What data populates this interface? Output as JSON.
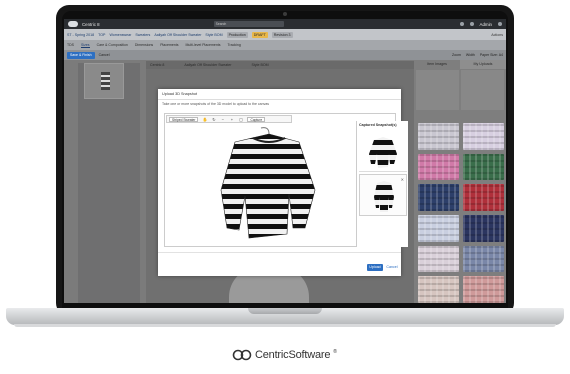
{
  "app": {
    "title": "Centric 8",
    "user": "Admin",
    "search_placeholder": "Search"
  },
  "breadcrumb": {
    "items": [
      "ST - Spring 2018",
      "TOP",
      "Womenswear",
      "Sweaters",
      "Aaliyah Off Shoulder Sweater",
      "Style BOM"
    ],
    "badges": [
      "Production",
      "DRAFT",
      "Revision 3"
    ],
    "actions_label": "Actions"
  },
  "tabs": [
    "TDS",
    "Sizes",
    "Care & Composition",
    "Dimensions",
    "Placements",
    "Multi-level Placements",
    "Tracking"
  ],
  "toolbar": {
    "save_label": "Save & Finish",
    "cancel_label": "Cancel",
    "zoom_label": "Zoom",
    "zoom_value": "Width",
    "paper_label": "Paper Size: A4"
  },
  "table_header": [
    "Centric 8",
    "Aaliyah Off Shoulder Sweater",
    "Style BOM"
  ],
  "right_panel": {
    "tabs": [
      "Item Images",
      "My Uploads"
    ]
  },
  "modal": {
    "title": "Upload 3D Snapshot",
    "description": "Take one or more snapshots of the 3D model to upload to the canvas",
    "view_select": "Striped Sweater",
    "capture_label": "Capture",
    "captured_title": "Captured Snapshot(s)",
    "upload_label": "Upload",
    "cancel_label": "Cancel"
  },
  "swatches": [
    "#c9c7d1",
    "#d7cfe0",
    "#d17aa8",
    "#3a6e4b",
    "#2d3f6a",
    "#b0303b",
    "#c9cfe0",
    "#2b3560",
    "#d9d0d9",
    "#7a87a8",
    "#d6c5c0",
    "#cf9a9a"
  ],
  "brand": {
    "name": "CentricSoftware",
    "trademark": "®"
  }
}
